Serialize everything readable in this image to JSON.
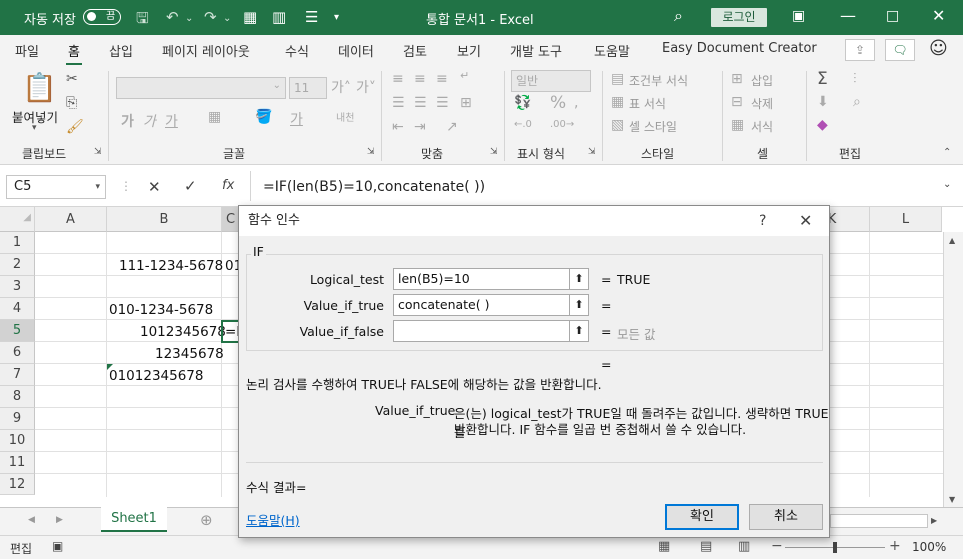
{
  "titlebar": {
    "autosave_label": "자동 저장",
    "autosave_state": "끔",
    "title": "통합 문서1 - Excel",
    "login_label": "로그인"
  },
  "tabs": [
    "파일",
    "홈",
    "삽입",
    "페이지 레이아웃",
    "수식",
    "데이터",
    "검토",
    "보기",
    "개발 도구",
    "도움말",
    "Easy Document Creator"
  ],
  "active_tab": "홈",
  "ribbon": {
    "groups": [
      "클립보드",
      "글꼴",
      "맞춤",
      "표시 형식",
      "스타일",
      "셀",
      "편집"
    ],
    "paste_label": "붙여넣기",
    "font_size": "11",
    "number_format": "일반",
    "styles": [
      "조건부 서식",
      "표 서식",
      "셀 스타일"
    ],
    "cells": [
      "삽입",
      "삭제",
      "서식"
    ]
  },
  "formula_bar": {
    "name_box": "C5",
    "fx_label": "fx",
    "formula": "=IF(len(B5)=10,concatenate( ))"
  },
  "grid": {
    "columns": [
      "A",
      "B",
      "C",
      "K",
      "L"
    ],
    "rows": [
      "1",
      "2",
      "3",
      "4",
      "5",
      "6",
      "7",
      "8",
      "9",
      "10",
      "11",
      "12"
    ],
    "cells": {
      "B2": "111-1234-5678",
      "C2": "01",
      "B4": "010-1234-5678",
      "B5": "1012345678",
      "C5": "=I",
      "B6": "12345678",
      "B7": "01012345678"
    }
  },
  "sheet_tab": "Sheet1",
  "status": {
    "mode": "편집",
    "zoom": "100%"
  },
  "dialog": {
    "title": "함수 인수",
    "help_q": "?",
    "function_name": "IF",
    "args": [
      {
        "label": "Logical_test",
        "value": "len(B5)=10",
        "result": "TRUE"
      },
      {
        "label": "Value_if_true",
        "value": "concatenate( )",
        "result": ""
      },
      {
        "label": "Value_if_false",
        "value": "",
        "result": "모든 값"
      }
    ],
    "equals": "=",
    "description": "논리 검사를 수행하여 TRUE나 FALSE에 해당하는 값을 반환합니다.",
    "arg_help_name": "Value_if_true",
    "arg_help_line1": "은(는) logical_test가 TRUE일 때 돌려주는 값입니다. 생략하면 TRUE를",
    "arg_help_line2": "반환합니다. IF 함수를 일곱 번 중첩해서 쓸 수 있습니다.",
    "result_label": "수식 결과=",
    "help_link": "도움말(H)",
    "ok_label": "확인",
    "cancel_label": "취소"
  }
}
